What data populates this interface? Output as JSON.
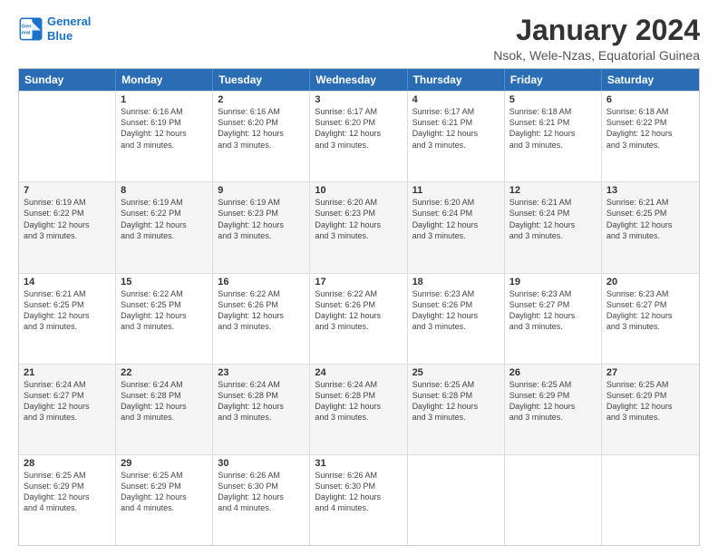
{
  "logo": {
    "line1": "General",
    "line2": "Blue"
  },
  "title": "January 2024",
  "subtitle": "Nsok, Wele-Nzas, Equatorial Guinea",
  "days": [
    "Sunday",
    "Monday",
    "Tuesday",
    "Wednesday",
    "Thursday",
    "Friday",
    "Saturday"
  ],
  "weeks": [
    [
      {
        "day": "",
        "shaded": false,
        "lines": []
      },
      {
        "day": "1",
        "shaded": false,
        "lines": [
          "Sunrise: 6:16 AM",
          "Sunset: 6:19 PM",
          "Daylight: 12 hours",
          "and 3 minutes."
        ]
      },
      {
        "day": "2",
        "shaded": false,
        "lines": [
          "Sunrise: 6:16 AM",
          "Sunset: 6:20 PM",
          "Daylight: 12 hours",
          "and 3 minutes."
        ]
      },
      {
        "day": "3",
        "shaded": false,
        "lines": [
          "Sunrise: 6:17 AM",
          "Sunset: 6:20 PM",
          "Daylight: 12 hours",
          "and 3 minutes."
        ]
      },
      {
        "day": "4",
        "shaded": false,
        "lines": [
          "Sunrise: 6:17 AM",
          "Sunset: 6:21 PM",
          "Daylight: 12 hours",
          "and 3 minutes."
        ]
      },
      {
        "day": "5",
        "shaded": false,
        "lines": [
          "Sunrise: 6:18 AM",
          "Sunset: 6:21 PM",
          "Daylight: 12 hours",
          "and 3 minutes."
        ]
      },
      {
        "day": "6",
        "shaded": false,
        "lines": [
          "Sunrise: 6:18 AM",
          "Sunset: 6:22 PM",
          "Daylight: 12 hours",
          "and 3 minutes."
        ]
      }
    ],
    [
      {
        "day": "7",
        "shaded": true,
        "lines": [
          "Sunrise: 6:19 AM",
          "Sunset: 6:22 PM",
          "Daylight: 12 hours",
          "and 3 minutes."
        ]
      },
      {
        "day": "8",
        "shaded": true,
        "lines": [
          "Sunrise: 6:19 AM",
          "Sunset: 6:22 PM",
          "Daylight: 12 hours",
          "and 3 minutes."
        ]
      },
      {
        "day": "9",
        "shaded": true,
        "lines": [
          "Sunrise: 6:19 AM",
          "Sunset: 6:23 PM",
          "Daylight: 12 hours",
          "and 3 minutes."
        ]
      },
      {
        "day": "10",
        "shaded": true,
        "lines": [
          "Sunrise: 6:20 AM",
          "Sunset: 6:23 PM",
          "Daylight: 12 hours",
          "and 3 minutes."
        ]
      },
      {
        "day": "11",
        "shaded": true,
        "lines": [
          "Sunrise: 6:20 AM",
          "Sunset: 6:24 PM",
          "Daylight: 12 hours",
          "and 3 minutes."
        ]
      },
      {
        "day": "12",
        "shaded": true,
        "lines": [
          "Sunrise: 6:21 AM",
          "Sunset: 6:24 PM",
          "Daylight: 12 hours",
          "and 3 minutes."
        ]
      },
      {
        "day": "13",
        "shaded": true,
        "lines": [
          "Sunrise: 6:21 AM",
          "Sunset: 6:25 PM",
          "Daylight: 12 hours",
          "and 3 minutes."
        ]
      }
    ],
    [
      {
        "day": "14",
        "shaded": false,
        "lines": [
          "Sunrise: 6:21 AM",
          "Sunset: 6:25 PM",
          "Daylight: 12 hours",
          "and 3 minutes."
        ]
      },
      {
        "day": "15",
        "shaded": false,
        "lines": [
          "Sunrise: 6:22 AM",
          "Sunset: 6:25 PM",
          "Daylight: 12 hours",
          "and 3 minutes."
        ]
      },
      {
        "day": "16",
        "shaded": false,
        "lines": [
          "Sunrise: 6:22 AM",
          "Sunset: 6:26 PM",
          "Daylight: 12 hours",
          "and 3 minutes."
        ]
      },
      {
        "day": "17",
        "shaded": false,
        "lines": [
          "Sunrise: 6:22 AM",
          "Sunset: 6:26 PM",
          "Daylight: 12 hours",
          "and 3 minutes."
        ]
      },
      {
        "day": "18",
        "shaded": false,
        "lines": [
          "Sunrise: 6:23 AM",
          "Sunset: 6:26 PM",
          "Daylight: 12 hours",
          "and 3 minutes."
        ]
      },
      {
        "day": "19",
        "shaded": false,
        "lines": [
          "Sunrise: 6:23 AM",
          "Sunset: 6:27 PM",
          "Daylight: 12 hours",
          "and 3 minutes."
        ]
      },
      {
        "day": "20",
        "shaded": false,
        "lines": [
          "Sunrise: 6:23 AM",
          "Sunset: 6:27 PM",
          "Daylight: 12 hours",
          "and 3 minutes."
        ]
      }
    ],
    [
      {
        "day": "21",
        "shaded": true,
        "lines": [
          "Sunrise: 6:24 AM",
          "Sunset: 6:27 PM",
          "Daylight: 12 hours",
          "and 3 minutes."
        ]
      },
      {
        "day": "22",
        "shaded": true,
        "lines": [
          "Sunrise: 6:24 AM",
          "Sunset: 6:28 PM",
          "Daylight: 12 hours",
          "and 3 minutes."
        ]
      },
      {
        "day": "23",
        "shaded": true,
        "lines": [
          "Sunrise: 6:24 AM",
          "Sunset: 6:28 PM",
          "Daylight: 12 hours",
          "and 3 minutes."
        ]
      },
      {
        "day": "24",
        "shaded": true,
        "lines": [
          "Sunrise: 6:24 AM",
          "Sunset: 6:28 PM",
          "Daylight: 12 hours",
          "and 3 minutes."
        ]
      },
      {
        "day": "25",
        "shaded": true,
        "lines": [
          "Sunrise: 6:25 AM",
          "Sunset: 6:28 PM",
          "Daylight: 12 hours",
          "and 3 minutes."
        ]
      },
      {
        "day": "26",
        "shaded": true,
        "lines": [
          "Sunrise: 6:25 AM",
          "Sunset: 6:29 PM",
          "Daylight: 12 hours",
          "and 3 minutes."
        ]
      },
      {
        "day": "27",
        "shaded": true,
        "lines": [
          "Sunrise: 6:25 AM",
          "Sunset: 6:29 PM",
          "Daylight: 12 hours",
          "and 3 minutes."
        ]
      }
    ],
    [
      {
        "day": "28",
        "shaded": false,
        "lines": [
          "Sunrise: 6:25 AM",
          "Sunset: 6:29 PM",
          "Daylight: 12 hours",
          "and 4 minutes."
        ]
      },
      {
        "day": "29",
        "shaded": false,
        "lines": [
          "Sunrise: 6:25 AM",
          "Sunset: 6:29 PM",
          "Daylight: 12 hours",
          "and 4 minutes."
        ]
      },
      {
        "day": "30",
        "shaded": false,
        "lines": [
          "Sunrise: 6:26 AM",
          "Sunset: 6:30 PM",
          "Daylight: 12 hours",
          "and 4 minutes."
        ]
      },
      {
        "day": "31",
        "shaded": false,
        "lines": [
          "Sunrise: 6:26 AM",
          "Sunset: 6:30 PM",
          "Daylight: 12 hours",
          "and 4 minutes."
        ]
      },
      {
        "day": "",
        "shaded": false,
        "lines": []
      },
      {
        "day": "",
        "shaded": false,
        "lines": []
      },
      {
        "day": "",
        "shaded": false,
        "lines": []
      }
    ]
  ]
}
